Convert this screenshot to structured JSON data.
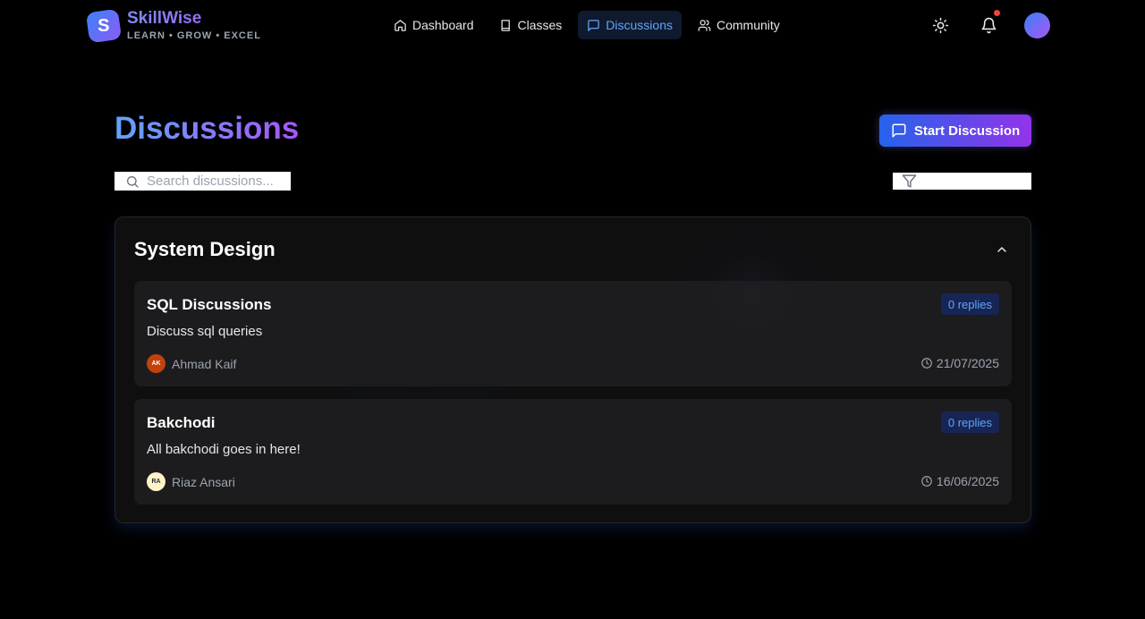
{
  "brand": {
    "logo_letter": "S",
    "name": "SkillWise",
    "tagline": "LEARN • GROW • EXCEL"
  },
  "nav": {
    "items": [
      {
        "label": "Dashboard",
        "icon": "home-icon"
      },
      {
        "label": "Classes",
        "icon": "book-icon"
      },
      {
        "label": "Discussions",
        "icon": "message-square-icon",
        "active": true
      },
      {
        "label": "Community",
        "icon": "users-icon"
      }
    ]
  },
  "header_actions": {
    "theme_icon": "sun-icon",
    "notification_icon": "bell-icon",
    "has_unread": true
  },
  "page": {
    "title": "Discussions",
    "start_button": "Start Discussion",
    "search_placeholder": "Search discussions...",
    "filter_value": ""
  },
  "group": {
    "title": "System Design",
    "expanded": true,
    "posts": [
      {
        "title": "SQL Discussions",
        "description": "Discuss sql queries",
        "replies": "0 replies",
        "author": "Ahmad Kaif",
        "initials": "AK",
        "avatar_bg": "#c2410c",
        "avatar_fg": "#ffffff",
        "date": "21/07/2025"
      },
      {
        "title": "Bakchodi",
        "description": "All bakchodi goes in here!",
        "replies": "0 replies",
        "author": "Riaz Ansari",
        "initials": "RA",
        "avatar_bg": "#fef3c7",
        "avatar_fg": "#1f2937",
        "date": "16/06/2025"
      }
    ]
  },
  "colors": {
    "accent_blue": "#60a5fa",
    "accent_purple": "#a855f7",
    "notification": "#ef4444"
  }
}
